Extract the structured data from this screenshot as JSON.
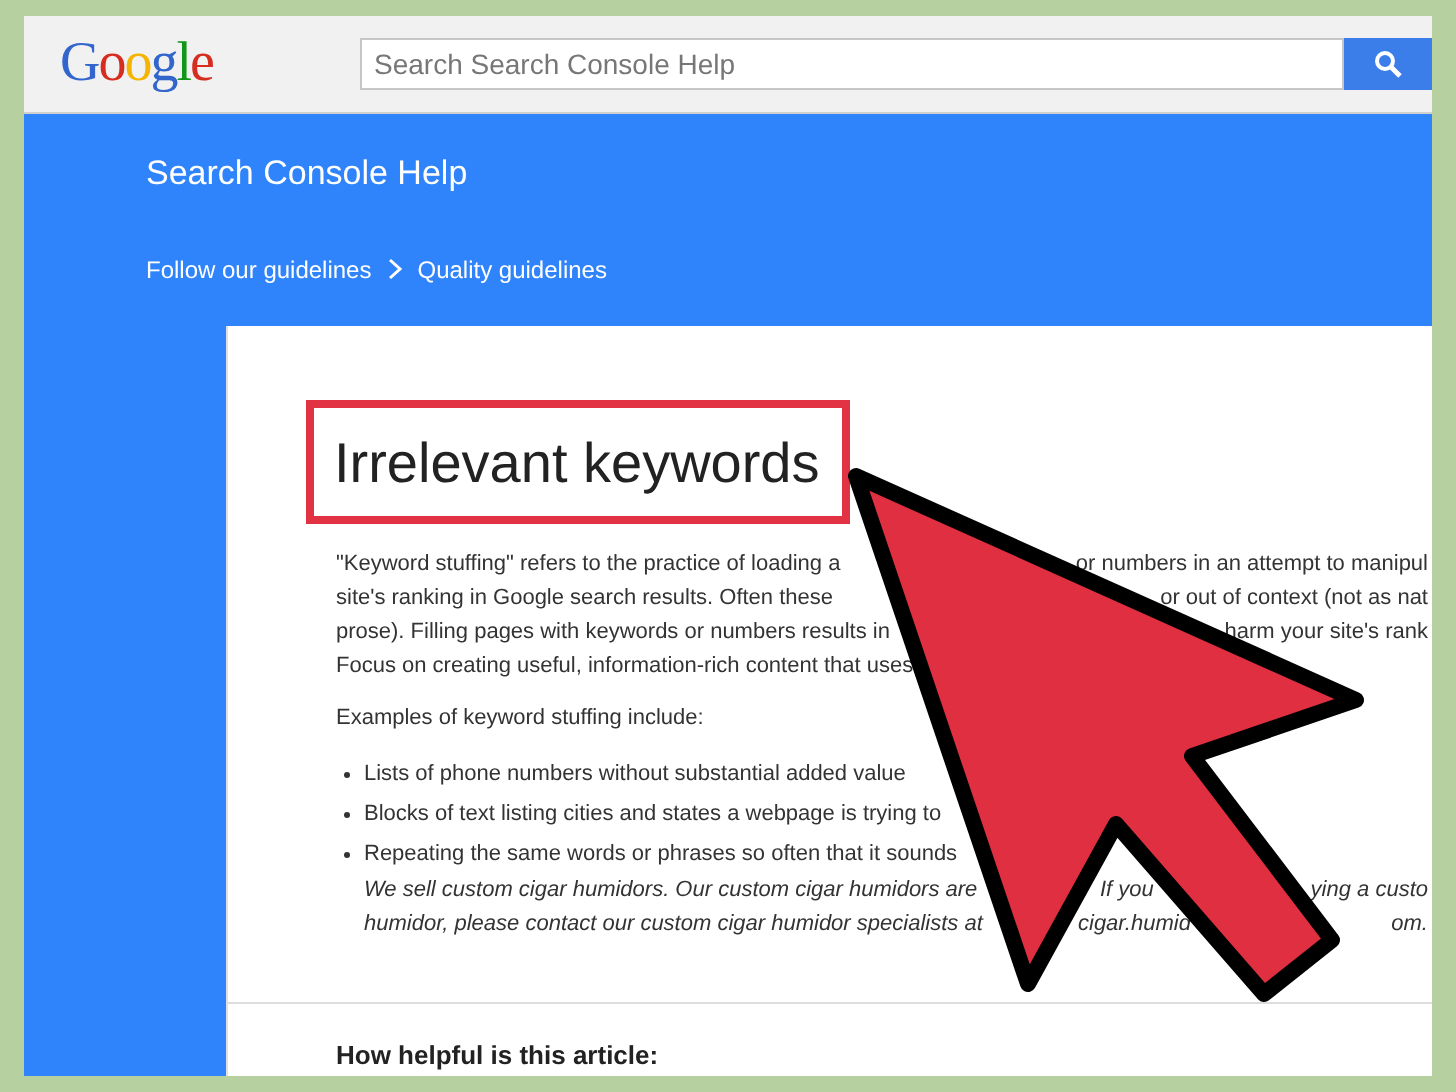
{
  "header": {
    "logo": "Google",
    "search": {
      "placeholder": "Search Search Console Help"
    }
  },
  "banner": {
    "title": "Search Console Help",
    "breadcrumbs": [
      "Follow our guidelines",
      "Quality guidelines"
    ]
  },
  "article": {
    "title": "Irrelevant keywords",
    "title_highlighted": true,
    "paragraph": [
      [
        "\"Keyword stuffing\" refers to the practice of loading a",
        "or numbers in an attempt to manipul"
      ],
      [
        "site's ranking in Google search results. Often these",
        "or out of context (not as nat"
      ],
      [
        "prose). Filling pages with keywords or numbers results in",
        "harm your site's rank"
      ],
      [
        "Focus on creating useful, information-rich content that uses"
      ]
    ],
    "examples_intro": "Examples of keyword stuffing include:",
    "bullets": [
      {
        "lines": [
          [
            "Lists of phone numbers without substantial added value"
          ]
        ]
      },
      {
        "lines": [
          [
            "Blocks of text listing cities and states a webpage is trying to"
          ]
        ]
      },
      {
        "lines": [
          [
            "Repeating the same words or phrases so often that it sounds"
          ],
          [
            "We sell custom cigar humidors. Our custom cigar humidors are",
            "If you",
            "ying a custo"
          ],
          [
            "humidor, please contact our custom cigar humidor specialists at",
            "cigar.humid",
            "om."
          ]
        ]
      }
    ],
    "feedback_prompt": "How helpful is this article:"
  }
}
